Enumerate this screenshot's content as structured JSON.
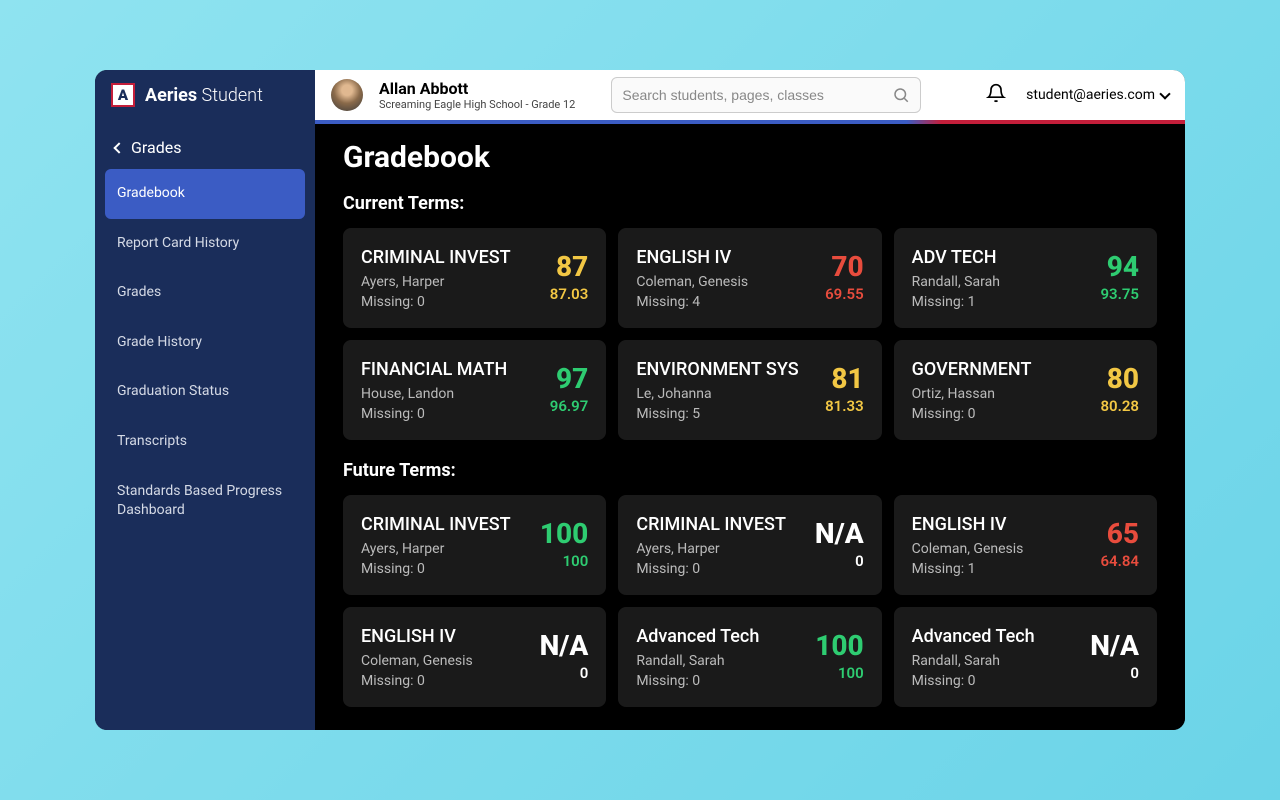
{
  "brand": {
    "name_bold": "Aeries",
    "name_light": " Student",
    "logo_letter": "A"
  },
  "sidebar": {
    "header": "Grades",
    "items": [
      {
        "label": "Gradebook",
        "active": true
      },
      {
        "label": "Report Card History",
        "active": false
      },
      {
        "label": "Grades",
        "active": false
      },
      {
        "label": "Grade History",
        "active": false
      },
      {
        "label": "Graduation Status",
        "active": false
      },
      {
        "label": "Transcripts",
        "active": false
      },
      {
        "label": "Standards Based Progress Dashboard",
        "active": false
      }
    ]
  },
  "header": {
    "student_name": "Allan Abbott",
    "student_school": "Screaming Eagle High School - Grade 12",
    "search_placeholder": "Search students, pages, classes",
    "user_email": "student@aeries.com"
  },
  "page": {
    "title": "Gradebook",
    "missing_label_prefix": "Missing: ",
    "sections": [
      {
        "title": "Current Terms:",
        "cards": [
          {
            "course": "CRIMINAL INVEST",
            "teacher": "Ayers, Harper",
            "missing": 0,
            "grade": "87",
            "pct": "87.03",
            "color": "yellow"
          },
          {
            "course": "ENGLISH IV",
            "teacher": "Coleman, Genesis",
            "missing": 4,
            "grade": "70",
            "pct": "69.55",
            "color": "red"
          },
          {
            "course": "ADV TECH",
            "teacher": "Randall, Sarah",
            "missing": 1,
            "grade": "94",
            "pct": "93.75",
            "color": "green"
          },
          {
            "course": "FINANCIAL MATH",
            "teacher": "House, Landon",
            "missing": 0,
            "grade": "97",
            "pct": "96.97",
            "color": "green"
          },
          {
            "course": "ENVIRONMENT SYS",
            "teacher": "Le, Johanna",
            "missing": 5,
            "grade": "81",
            "pct": "81.33",
            "color": "yellow"
          },
          {
            "course": "GOVERNMENT",
            "teacher": "Ortiz, Hassan",
            "missing": 0,
            "grade": "80",
            "pct": "80.28",
            "color": "yellow"
          }
        ]
      },
      {
        "title": "Future Terms:",
        "cards": [
          {
            "course": "CRIMINAL INVEST",
            "teacher": "Ayers, Harper",
            "missing": 0,
            "grade": "100",
            "pct": "100",
            "color": "green"
          },
          {
            "course": "CRIMINAL INVEST",
            "teacher": "Ayers, Harper",
            "missing": 0,
            "grade": "N/A",
            "pct": "0",
            "color": "white"
          },
          {
            "course": "ENGLISH IV",
            "teacher": "Coleman, Genesis",
            "missing": 1,
            "grade": "65",
            "pct": "64.84",
            "color": "red"
          },
          {
            "course": "ENGLISH IV",
            "teacher": "Coleman, Genesis",
            "missing": 0,
            "grade": "N/A",
            "pct": "0",
            "color": "white"
          },
          {
            "course": "Advanced Tech",
            "teacher": "Randall, Sarah",
            "missing": 0,
            "grade": "100",
            "pct": "100",
            "color": "green"
          },
          {
            "course": "Advanced Tech",
            "teacher": "Randall, Sarah",
            "missing": 0,
            "grade": "N/A",
            "pct": "0",
            "color": "white"
          }
        ]
      }
    ]
  }
}
